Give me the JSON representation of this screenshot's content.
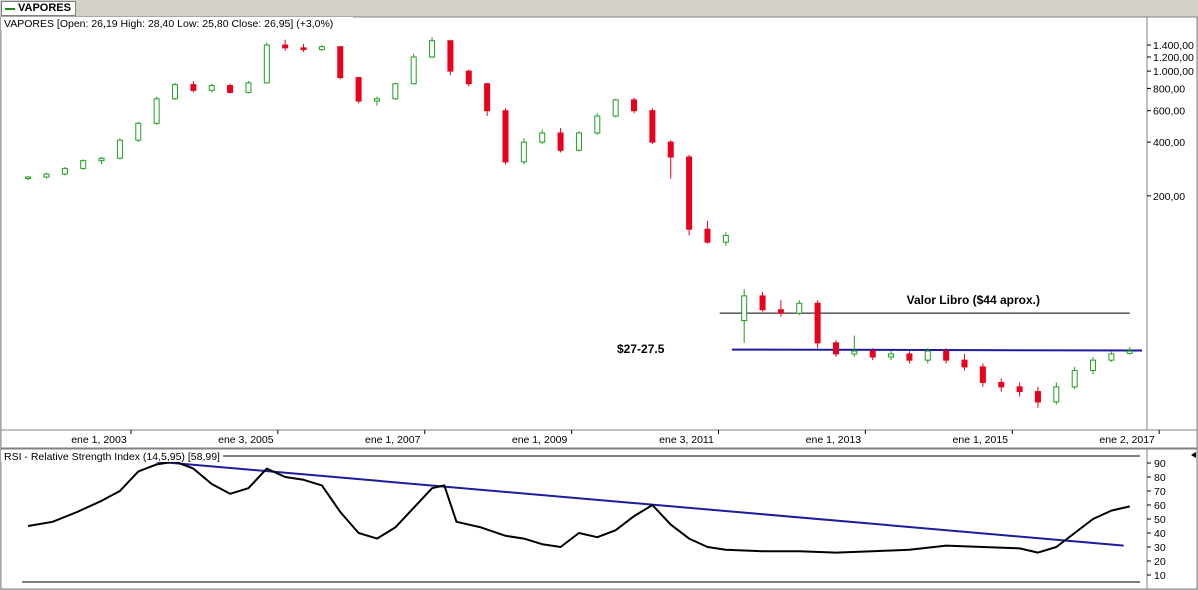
{
  "symbol_tab": "VAPORES",
  "price_panel": {
    "legend": "VAPORES [Open: 26,19  High: 28,40  Low: 25,80  Close: 26,95] (+3,0%)",
    "y_ticks": [
      "1.400,00",
      "1.200,00",
      "1.000,00",
      "800,00",
      "600,00",
      "400,00",
      "200,00"
    ],
    "x_ticks": [
      "ene 1, 2003",
      "ene 3, 2005",
      "ene 1, 2007",
      "ene 1, 2009",
      "ene 3, 2011",
      "ene 1, 2013",
      "ene 1, 2015",
      "ene 2, 2017"
    ],
    "annotations": {
      "book_value": "Valor Libro ($44 aprox.)",
      "support": "$27-27.5"
    }
  },
  "rsi_panel": {
    "legend": "RSI - Relative Strength Index (14,5,95) [58,99]",
    "y_ticks": [
      "90",
      "80",
      "70",
      "60",
      "50",
      "40",
      "30",
      "20",
      "10"
    ]
  },
  "colors": {
    "up": "#1f9e1f",
    "down": "#e8001c",
    "trendline": "#1c1c9c",
    "rsi_line": "#000000",
    "panel_bg": "#ffffff",
    "chrome": "#d4d0c8"
  },
  "chart_data": [
    {
      "type": "candlestick",
      "scale": "log",
      "ylim": [
        10,
        1700
      ],
      "xlim": [
        "2002-05",
        "2017-08"
      ],
      "series": [
        {
          "name": "VAPORES",
          "values": [
            {
              "d": "2002-06",
              "o": 250,
              "h": 258,
              "l": 245,
              "c": 255
            },
            {
              "d": "2002-09",
              "o": 255,
              "h": 270,
              "l": 250,
              "c": 265
            },
            {
              "d": "2002-12",
              "o": 265,
              "h": 290,
              "l": 260,
              "c": 285
            },
            {
              "d": "2003-03",
              "o": 285,
              "h": 320,
              "l": 280,
              "c": 315
            },
            {
              "d": "2003-06",
              "o": 315,
              "h": 330,
              "l": 300,
              "c": 325
            },
            {
              "d": "2003-09",
              "o": 325,
              "h": 420,
              "l": 320,
              "c": 410
            },
            {
              "d": "2003-12",
              "o": 410,
              "h": 520,
              "l": 400,
              "c": 510
            },
            {
              "d": "2004-03",
              "o": 510,
              "h": 720,
              "l": 500,
              "c": 700
            },
            {
              "d": "2004-06",
              "o": 700,
              "h": 860,
              "l": 690,
              "c": 840
            },
            {
              "d": "2004-09",
              "o": 840,
              "h": 880,
              "l": 760,
              "c": 780
            },
            {
              "d": "2004-12",
              "o": 780,
              "h": 850,
              "l": 760,
              "c": 830
            },
            {
              "d": "2005-03",
              "o": 830,
              "h": 850,
              "l": 750,
              "c": 760
            },
            {
              "d": "2005-06",
              "o": 760,
              "h": 880,
              "l": 750,
              "c": 860
            },
            {
              "d": "2005-09",
              "o": 860,
              "h": 1450,
              "l": 850,
              "c": 1400
            },
            {
              "d": "2005-12",
              "o": 1400,
              "h": 1500,
              "l": 1300,
              "c": 1350
            },
            {
              "d": "2006-03",
              "o": 1350,
              "h": 1420,
              "l": 1280,
              "c": 1320
            },
            {
              "d": "2006-06",
              "o": 1320,
              "h": 1400,
              "l": 1300,
              "c": 1370
            },
            {
              "d": "2006-09",
              "o": 1370,
              "h": 1380,
              "l": 900,
              "c": 920
            },
            {
              "d": "2006-12",
              "o": 920,
              "h": 930,
              "l": 660,
              "c": 680
            },
            {
              "d": "2007-03",
              "o": 680,
              "h": 720,
              "l": 640,
              "c": 700
            },
            {
              "d": "2007-06",
              "o": 700,
              "h": 860,
              "l": 690,
              "c": 850
            },
            {
              "d": "2007-09",
              "o": 850,
              "h": 1250,
              "l": 840,
              "c": 1200
            },
            {
              "d": "2007-12",
              "o": 1200,
              "h": 1550,
              "l": 1180,
              "c": 1480
            },
            {
              "d": "2008-03",
              "o": 1480,
              "h": 1500,
              "l": 950,
              "c": 1000
            },
            {
              "d": "2008-06",
              "o": 1000,
              "h": 1020,
              "l": 820,
              "c": 850
            },
            {
              "d": "2008-09",
              "o": 850,
              "h": 860,
              "l": 560,
              "c": 600
            },
            {
              "d": "2008-12",
              "o": 600,
              "h": 620,
              "l": 300,
              "c": 310
            },
            {
              "d": "2009-03",
              "o": 310,
              "h": 420,
              "l": 300,
              "c": 400
            },
            {
              "d": "2009-06",
              "o": 400,
              "h": 470,
              "l": 390,
              "c": 450
            },
            {
              "d": "2009-09",
              "o": 450,
              "h": 480,
              "l": 350,
              "c": 360
            },
            {
              "d": "2009-12",
              "o": 360,
              "h": 460,
              "l": 355,
              "c": 450
            },
            {
              "d": "2010-03",
              "o": 450,
              "h": 580,
              "l": 440,
              "c": 560
            },
            {
              "d": "2010-06",
              "o": 560,
              "h": 700,
              "l": 550,
              "c": 690
            },
            {
              "d": "2010-09",
              "o": 690,
              "h": 710,
              "l": 580,
              "c": 600
            },
            {
              "d": "2010-12",
              "o": 600,
              "h": 620,
              "l": 390,
              "c": 400
            },
            {
              "d": "2011-03",
              "o": 400,
              "h": 410,
              "l": 250,
              "c": 330
            },
            {
              "d": "2011-06",
              "o": 330,
              "h": 340,
              "l": 120,
              "c": 130
            },
            {
              "d": "2011-09",
              "o": 130,
              "h": 145,
              "l": 108,
              "c": 110
            },
            {
              "d": "2011-12",
              "o": 110,
              "h": 125,
              "l": 105,
              "c": 120
            },
            {
              "d": "2012-03",
              "o": 40,
              "h": 60,
              "l": 30,
              "c": 55
            },
            {
              "d": "2012-06",
              "o": 55,
              "h": 58,
              "l": 45,
              "c": 46
            },
            {
              "d": "2012-09",
              "o": 46,
              "h": 52,
              "l": 42,
              "c": 44
            },
            {
              "d": "2012-12",
              "o": 44,
              "h": 52,
              "l": 43,
              "c": 50
            },
            {
              "d": "2013-03",
              "o": 50,
              "h": 52,
              "l": 28,
              "c": 30
            },
            {
              "d": "2013-06",
              "o": 30,
              "h": 31,
              "l": 25,
              "c": 26
            },
            {
              "d": "2013-09",
              "o": 26,
              "h": 33,
              "l": 25,
              "c": 27
            },
            {
              "d": "2013-12",
              "o": 27,
              "h": 28,
              "l": 24,
              "c": 25
            },
            {
              "d": "2014-03",
              "o": 25,
              "h": 27,
              "l": 24,
              "c": 26
            },
            {
              "d": "2014-06",
              "o": 26,
              "h": 27,
              "l": 23,
              "c": 24
            },
            {
              "d": "2014-09",
              "o": 24,
              "h": 28,
              "l": 23,
              "c": 27
            },
            {
              "d": "2014-12",
              "o": 27,
              "h": 28,
              "l": 23,
              "c": 24
            },
            {
              "d": "2015-03",
              "o": 24,
              "h": 26,
              "l": 21,
              "c": 22
            },
            {
              "d": "2015-06",
              "o": 22,
              "h": 23,
              "l": 17,
              "c": 18
            },
            {
              "d": "2015-09",
              "o": 18,
              "h": 19,
              "l": 16,
              "c": 17
            },
            {
              "d": "2015-12",
              "o": 17,
              "h": 18,
              "l": 15,
              "c": 16
            },
            {
              "d": "2016-03",
              "o": 16,
              "h": 17,
              "l": 13,
              "c": 14
            },
            {
              "d": "2016-06",
              "o": 14,
              "h": 18,
              "l": 13.5,
              "c": 17
            },
            {
              "d": "2016-09",
              "o": 17,
              "h": 22,
              "l": 16.5,
              "c": 21
            },
            {
              "d": "2016-12",
              "o": 21,
              "h": 25,
              "l": 20,
              "c": 24
            },
            {
              "d": "2017-03",
              "o": 24,
              "h": 27,
              "l": 23.5,
              "c": 26
            },
            {
              "d": "2017-06",
              "o": 26.19,
              "h": 28.4,
              "l": 25.8,
              "c": 26.95
            }
          ]
        }
      ],
      "lines": [
        {
          "label": "Valor Libro ($44 aprox.)",
          "from": [
            "2011-11",
            44
          ],
          "to": [
            "2017-06",
            44
          ]
        },
        {
          "label": "$27-27.5",
          "from": [
            "2012-01",
            27.5
          ],
          "to": [
            "2017-08",
            27.2
          ]
        }
      ]
    },
    {
      "type": "line",
      "ylim": [
        0,
        100
      ],
      "xlim": [
        "2002-05",
        "2017-08"
      ],
      "series": [
        {
          "name": "RSI",
          "values": [
            [
              "2002-06",
              45
            ],
            [
              "2002-10",
              48
            ],
            [
              "2003-02",
              55
            ],
            [
              "2003-06",
              63
            ],
            [
              "2003-09",
              70
            ],
            [
              "2003-12",
              84
            ],
            [
              "2004-03",
              89
            ],
            [
              "2004-06",
              91
            ],
            [
              "2004-09",
              86
            ],
            [
              "2004-12",
              75
            ],
            [
              "2005-03",
              68
            ],
            [
              "2005-06",
              72
            ],
            [
              "2005-09",
              86
            ],
            [
              "2005-12",
              80
            ],
            [
              "2006-03",
              78
            ],
            [
              "2006-06",
              74
            ],
            [
              "2006-09",
              55
            ],
            [
              "2006-12",
              40
            ],
            [
              "2007-03",
              36
            ],
            [
              "2007-06",
              44
            ],
            [
              "2007-09",
              58
            ],
            [
              "2007-12",
              72
            ],
            [
              "2008-02",
              74
            ],
            [
              "2008-04",
              48
            ],
            [
              "2008-08",
              44
            ],
            [
              "2008-12",
              38
            ],
            [
              "2009-03",
              36
            ],
            [
              "2009-06",
              32
            ],
            [
              "2009-09",
              30
            ],
            [
              "2009-12",
              40
            ],
            [
              "2010-03",
              37
            ],
            [
              "2010-06",
              42
            ],
            [
              "2010-09",
              52
            ],
            [
              "2010-12",
              60
            ],
            [
              "2011-03",
              46
            ],
            [
              "2011-06",
              36
            ],
            [
              "2011-09",
              30
            ],
            [
              "2011-12",
              28
            ],
            [
              "2012-06",
              27
            ],
            [
              "2012-12",
              27
            ],
            [
              "2013-06",
              26
            ],
            [
              "2013-12",
              27
            ],
            [
              "2014-06",
              28
            ],
            [
              "2014-12",
              31
            ],
            [
              "2015-06",
              30
            ],
            [
              "2015-12",
              29
            ],
            [
              "2016-03",
              26
            ],
            [
              "2016-06",
              30
            ],
            [
              "2016-09",
              40
            ],
            [
              "2016-12",
              50
            ],
            [
              "2017-03",
              56
            ],
            [
              "2017-06",
              59
            ]
          ]
        }
      ],
      "lines": [
        {
          "label": "",
          "from": [
            "2004-03",
            91
          ],
          "to": [
            "2017-05",
            31
          ]
        }
      ],
      "hlines": [
        95,
        5
      ]
    }
  ]
}
